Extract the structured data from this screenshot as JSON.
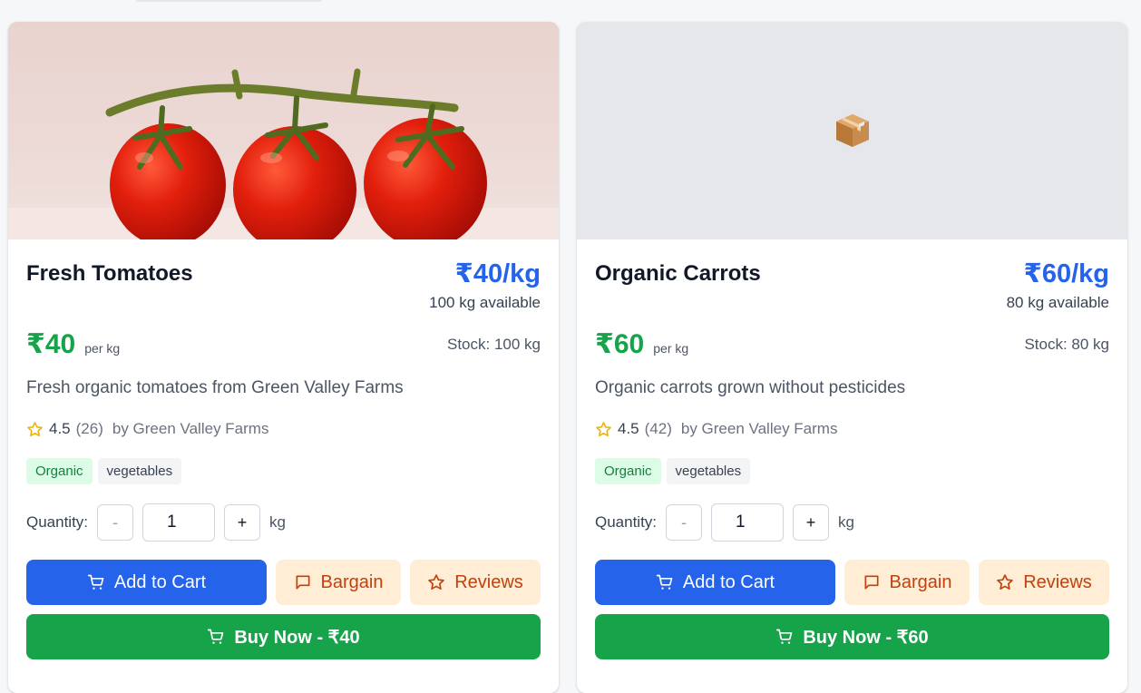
{
  "colors": {
    "accent_blue": "#2563eb",
    "accent_green": "#16a34a",
    "bargain_bg": "#ffedd5",
    "bargain_text": "#c2410c"
  },
  "labels": {
    "quantity": "Quantity:",
    "add_to_cart": "Add to Cart",
    "bargain": "Bargain",
    "reviews": "Reviews",
    "minus": "-",
    "plus": "+"
  },
  "products": [
    {
      "name": "Fresh Tomatoes",
      "unit_price": "₹40/kg",
      "available": "100 kg available",
      "price": "₹40",
      "per_unit": "per kg",
      "stock": "Stock: 100 kg",
      "description": "Fresh organic tomatoes from Green Valley Farms",
      "rating": "4.5",
      "review_count": "(26)",
      "seller": "by Green Valley Farms",
      "tags": [
        "Organic",
        "vegetables"
      ],
      "quantity": "1",
      "unit": "kg",
      "buy_now": "Buy Now - ₹40",
      "image": "tomatoes-photo"
    },
    {
      "name": "Organic Carrots",
      "unit_price": "₹60/kg",
      "available": "80 kg available",
      "price": "₹60",
      "per_unit": "per kg",
      "stock": "Stock: 80 kg",
      "description": "Organic carrots grown without pesticides",
      "rating": "4.5",
      "review_count": "(42)",
      "seller": "by Green Valley Farms",
      "tags": [
        "Organic",
        "vegetables"
      ],
      "quantity": "1",
      "unit": "kg",
      "buy_now": "Buy Now - ₹60",
      "image": "package-icon"
    }
  ]
}
